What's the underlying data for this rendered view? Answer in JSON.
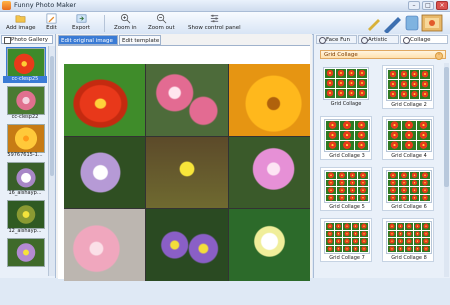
{
  "window": {
    "title": "Funny Photo Maker"
  },
  "toolbar": {
    "items": [
      {
        "label": "Add image",
        "icon": "folder-open-icon"
      },
      {
        "label": "Edit",
        "icon": "edit-icon"
      },
      {
        "label": "Export",
        "icon": "export-icon"
      },
      {
        "label": "Zoom in",
        "icon": "zoom-in-icon"
      },
      {
        "label": "Zoom out",
        "icon": "zoom-out-icon"
      },
      {
        "label": "Show control panel",
        "icon": "control-panel-icon"
      }
    ]
  },
  "left_panel": {
    "tab_label": "Photo Gallery",
    "items": [
      {
        "caption": "cc-clesp25",
        "selected": true
      },
      {
        "caption": "cc-clesp22",
        "selected": false
      },
      {
        "caption": "59767615-1...",
        "selected": false
      },
      {
        "caption": "16_aishayp...",
        "selected": false
      },
      {
        "caption": "12_aishayp...",
        "selected": false
      },
      {
        "caption": "",
        "selected": false
      }
    ]
  },
  "center": {
    "tabs": [
      {
        "label": "Edit original image",
        "active": true
      },
      {
        "label": "Edit template",
        "active": false
      }
    ]
  },
  "right_panel": {
    "tabs": [
      {
        "label": "Face Fun",
        "active": false
      },
      {
        "label": "Artistic",
        "active": false
      },
      {
        "label": "Collage",
        "active": true
      }
    ],
    "category": "Grid Collage",
    "templates": [
      {
        "caption": "Grid Collage",
        "grid": 1
      },
      {
        "caption": "Grid Collage 2",
        "grid": 2
      },
      {
        "caption": "Grid Collage 3",
        "grid": 3
      },
      {
        "caption": "Grid Collage 4",
        "grid": 3
      },
      {
        "caption": "Grid Collage 5",
        "grid": 4
      },
      {
        "caption": "Grid Collage 6",
        "grid": 4
      },
      {
        "caption": "Grid Collage 7",
        "grid": 5
      },
      {
        "caption": "Grid Collage 8",
        "grid": 5
      }
    ]
  },
  "colors": {
    "accent": "#3a7bd5",
    "tab_active_text": "#ffffff",
    "category_text": "#7a3a00"
  }
}
